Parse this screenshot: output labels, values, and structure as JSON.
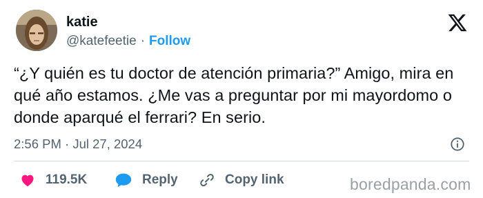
{
  "author": {
    "name": "katie",
    "handle": "@katefeetie",
    "separator": "·",
    "follow_label": "Follow"
  },
  "tweet": {
    "text": "“¿Y quién es tu doctor de atención primaria?” Amigo, mira en qué año estamos. ¿Me vas a preguntar por mi mayordomo o donde aparqué el ferrari? En serio.",
    "timestamp": "2:56 PM · Jul 27, 2024"
  },
  "actions": {
    "likes_count": "119.5K",
    "reply_label": "Reply",
    "copy_link_label": "Copy link"
  },
  "icons": {
    "brand": "x-logo-icon",
    "info": "info-icon",
    "like": "heart-icon",
    "reply": "speech-bubble-icon",
    "copy": "link-icon"
  },
  "colors": {
    "accent": "#1d9bf0",
    "like": "#f91880",
    "muted": "#536471"
  },
  "watermark": "boredpanda.com"
}
